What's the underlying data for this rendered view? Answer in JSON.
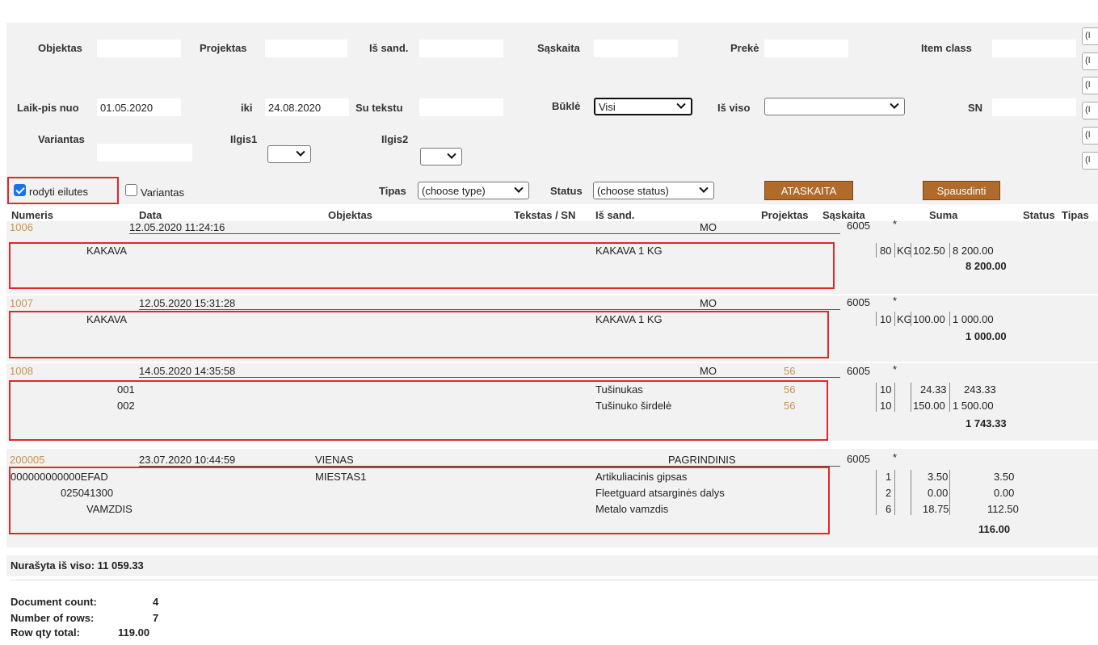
{
  "filters": {
    "objektas_label": "Objektas",
    "projektas_label": "Projektas",
    "issand_label": "Iš sand.",
    "saskaita_label": "Sąskaita",
    "preke_label": "Prekė",
    "itemclass_label": "Item class",
    "laikpis_label": "Laik-pis nuo",
    "laikpis_value": "01.05.2020",
    "iki_label": "iki",
    "iki_value": "24.08.2020",
    "sutekstu_label": "Su tekstu",
    "bukle_label": "Būklė",
    "bukle_value": "Visi",
    "isviso_label": "Iš viso",
    "sn_label": "SN",
    "variantas_label": "Variantas",
    "ilgis1_label": "Ilgis1",
    "ilgis2_label": "Ilgis2",
    "side_boxes": [
      "(I",
      "(I",
      "(I",
      "(I",
      "(I",
      "(I"
    ],
    "rodyti_label": "rodyti eilutes",
    "rodyti_checked": true,
    "variantas_cb_label": "Variantas",
    "variantas_checked": false,
    "tipas_label": "Tipas",
    "tipas_value": "(choose type)",
    "status_label": "Status",
    "status_value": "(choose status)",
    "ataskaita_button": "ATASKAITA",
    "spausdinti_button": "Spausdinti"
  },
  "columns": {
    "numeris": "Numeris",
    "data": "Data",
    "objektas": "Objektas",
    "tekstas": "Tekstas / SN",
    "issand": "Iš sand.",
    "projektas": "Projektas",
    "saskaita": "Sąskaita",
    "suma": "Suma",
    "status": "Status",
    "tipas": "Tipas"
  },
  "documents": [
    {
      "number": "1006",
      "date": "12.05.2020 11:24:16",
      "objektas": "",
      "issand": "MO",
      "projektas": "",
      "saskaita": "6005",
      "star": "*",
      "rows": [
        {
          "code": "KAKAVA",
          "objektas": "",
          "name": "KAKAVA 1 KG",
          "projektas": "",
          "qty": "80",
          "unit": "KG",
          "price": "102.50",
          "sum": "8 200.00"
        }
      ],
      "total": "8 200.00"
    },
    {
      "number": "1007",
      "date": "12.05.2020 15:31:28",
      "objektas": "",
      "issand": "MO",
      "projektas": "",
      "saskaita": "6005",
      "star": "*",
      "rows": [
        {
          "code": "KAKAVA",
          "objektas": "",
          "name": "KAKAVA 1 KG",
          "projektas": "",
          "qty": "10",
          "unit": "KG",
          "price": "100.00",
          "sum": "1 000.00"
        }
      ],
      "total": "1 000.00"
    },
    {
      "number": "1008",
      "date": "14.05.2020 14:35:58",
      "objektas": "",
      "issand": "MO",
      "projektas": "56",
      "saskaita": "6005",
      "star": "*",
      "rows": [
        {
          "code": "001",
          "objektas": "",
          "name": "Tušinukas",
          "projektas": "56",
          "qty": "10",
          "unit": "",
          "price": "24.33",
          "sum": "243.33"
        },
        {
          "code": "002",
          "objektas": "",
          "name": "Tušinuko širdelė",
          "projektas": "56",
          "qty": "10",
          "unit": "",
          "price": "150.00",
          "sum": "1 500.00"
        }
      ],
      "total": "1 743.33"
    },
    {
      "number": "200005",
      "date": "23.07.2020 10:44:59",
      "objektas": "VIENAS",
      "issand": "PAGRINDINIS",
      "projektas": "",
      "saskaita": "6005",
      "star": "*",
      "rows": [
        {
          "code": "000000000000EFAD",
          "objektas": "MIESTAS1",
          "name": "Artikuliacinis gipsas",
          "projektas": "",
          "qty": "1",
          "unit": "",
          "price": "3.50",
          "sum": "3.50"
        },
        {
          "code": "025041300",
          "objektas": "",
          "name": "Fleetguard atsarginės dalys",
          "projektas": "",
          "qty": "2",
          "unit": "",
          "price": "0.00",
          "sum": "0.00"
        },
        {
          "code": "VAMZDIS",
          "objektas": "",
          "name": "Metalo vamzdis",
          "projektas": "",
          "qty": "6",
          "unit": "",
          "price": "18.75",
          "sum": "112.50"
        }
      ],
      "total": "116.00"
    }
  ],
  "footer": {
    "total_text": "Nurašyta iš viso: 11 059.33",
    "doc_count_label": "Document count:",
    "doc_count": "4",
    "rows_label": "Number of rows:",
    "rows": "7",
    "rowqty_label": "Row qty total:",
    "rowqty": "119.00"
  },
  "colors": {
    "accent": "#b06a2a",
    "link": "#c9924f",
    "highlight": "#e0262e",
    "band": "#f2f2f2"
  }
}
